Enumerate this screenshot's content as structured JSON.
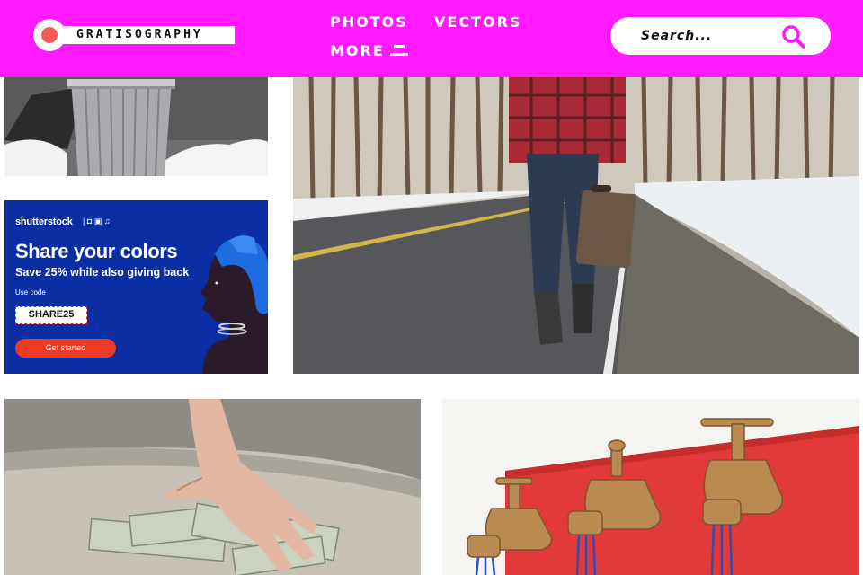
{
  "header": {
    "logo_text": "GRATISOGRAPHY",
    "nav": {
      "photos": "PHOTOS",
      "vectors": "VECTORS",
      "more": "MORE"
    },
    "search": {
      "placeholder": "Search..."
    }
  },
  "ad": {
    "brand": "shutterstock",
    "icons": "|  ◘  ▣  ♫",
    "headline": "Share your colors",
    "subhead": "Save 25% while also giving back",
    "use_code_label": "Use code",
    "code": "SHARE25",
    "cta": "Get started"
  },
  "photos": [
    {
      "name": "trash-can-in-snow"
    },
    {
      "name": "man-walking-on-road-with-suitcase"
    },
    {
      "name": "hand-picking-up-dollar-bills"
    },
    {
      "name": "three-brass-faucets-on-red-wall"
    }
  ],
  "colors": {
    "header_bg": "#ff1aff",
    "logo_dot": "#f25c5c",
    "ad_bg": "#0b2ea4",
    "ad_cta": "#ee3a24"
  }
}
